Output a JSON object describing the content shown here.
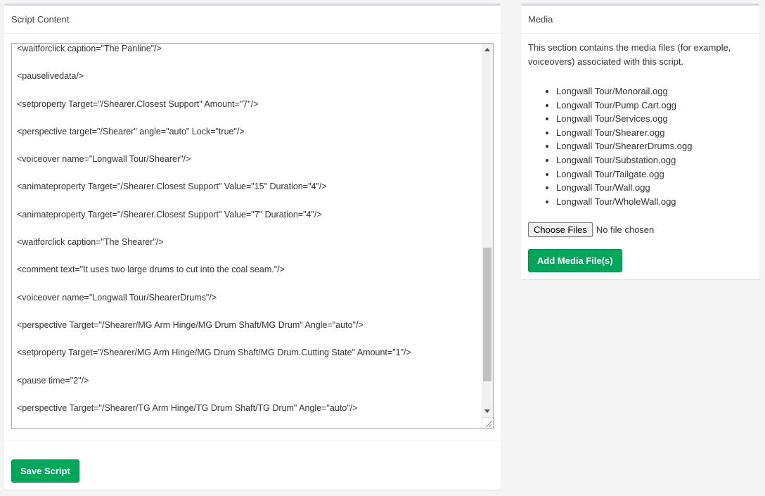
{
  "script_panel": {
    "title": "Script Content",
    "lines": [
      "<waitforclick caption=\"The Panline\"/>",
      "<pauselivedata/>",
      "<setproperty Target=\"/Shearer.Closest Support\" Amount=\"7\"/>",
      "<perspective target=\"/Shearer\" angle=\"auto\" Lock=\"true\"/>",
      "<voiceover name=\"Longwall Tour/Shearer\"/>",
      "<animateproperty Target=\"/Shearer.Closest Support\" Value=\"15\" Duration=\"4\"/>",
      "<animateproperty Target=\"/Shearer.Closest Support\" Value=\"7\" Duration=\"4\"/>",
      "<waitforclick caption=\"The Shearer\"/>",
      "<comment text=\"It uses two large drums to cut into the coal seam.\"/>",
      "<voiceover name=\"Longwall Tour/ShearerDrums\"/>",
      "<perspective Target=\"/Shearer/MG Arm Hinge/MG Drum Shaft/MG Drum\" Angle=\"auto\"/>",
      "<setproperty Target=\"/Shearer/MG Arm Hinge/MG Drum Shaft/MG Drum.Cutting State\" Amount=\"1\"/>",
      "<pause time=\"2\"/>",
      "<perspective Target=\"/Shearer/TG Arm Hinge/TG Drum Shaft/TG Drum\" Angle=\"auto\"/>"
    ],
    "save_label": "Save Script"
  },
  "media_panel": {
    "title": "Media",
    "description": "This section contains the media files (for example, voiceovers) associated with this script.",
    "files": [
      "Longwall Tour/Monorail.ogg",
      "Longwall Tour/Pump Cart.ogg",
      "Longwall Tour/Services.ogg",
      "Longwall Tour/Shearer.ogg",
      "Longwall Tour/ShearerDrums.ogg",
      "Longwall Tour/Substation.ogg",
      "Longwall Tour/Tailgate.ogg",
      "Longwall Tour/Wall.ogg",
      "Longwall Tour/WholeWall.ogg"
    ],
    "choose_label": "Choose Files",
    "no_file": "No file chosen",
    "add_label": "Add Media File(s)"
  },
  "colors": {
    "accent": "#00a65a"
  }
}
